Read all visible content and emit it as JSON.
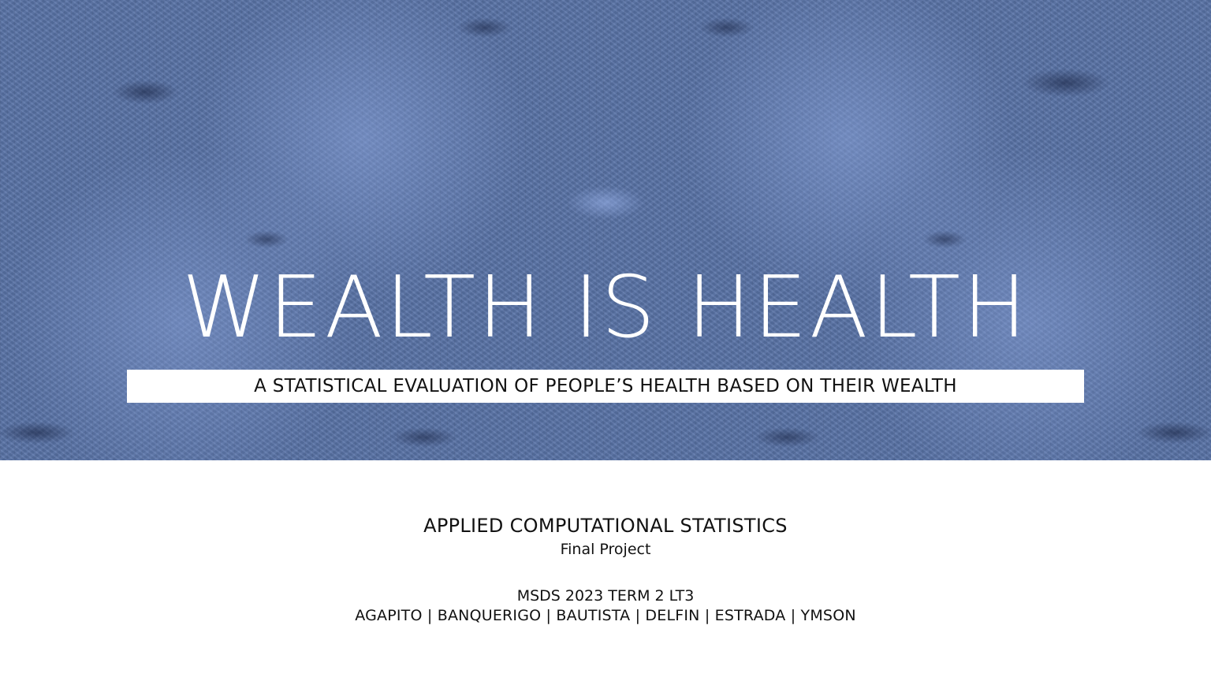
{
  "hero": {
    "title": "WEALTH IS HEALTH",
    "subtitle": "A STATISTICAL EVALUATION OF PEOPLE’S HEALTH BASED ON THEIR WEALTH",
    "background_color": "#5a74a8"
  },
  "info": {
    "course": "APPLIED COMPUTATIONAL STATISTICS",
    "project": "Final Project",
    "cohort": "MSDS 2023 TERM 2 LT3",
    "members": "AGAPITO | BANQUERIGO | BAUTISTA | DELFIN | ESTRADA | YMSON"
  }
}
